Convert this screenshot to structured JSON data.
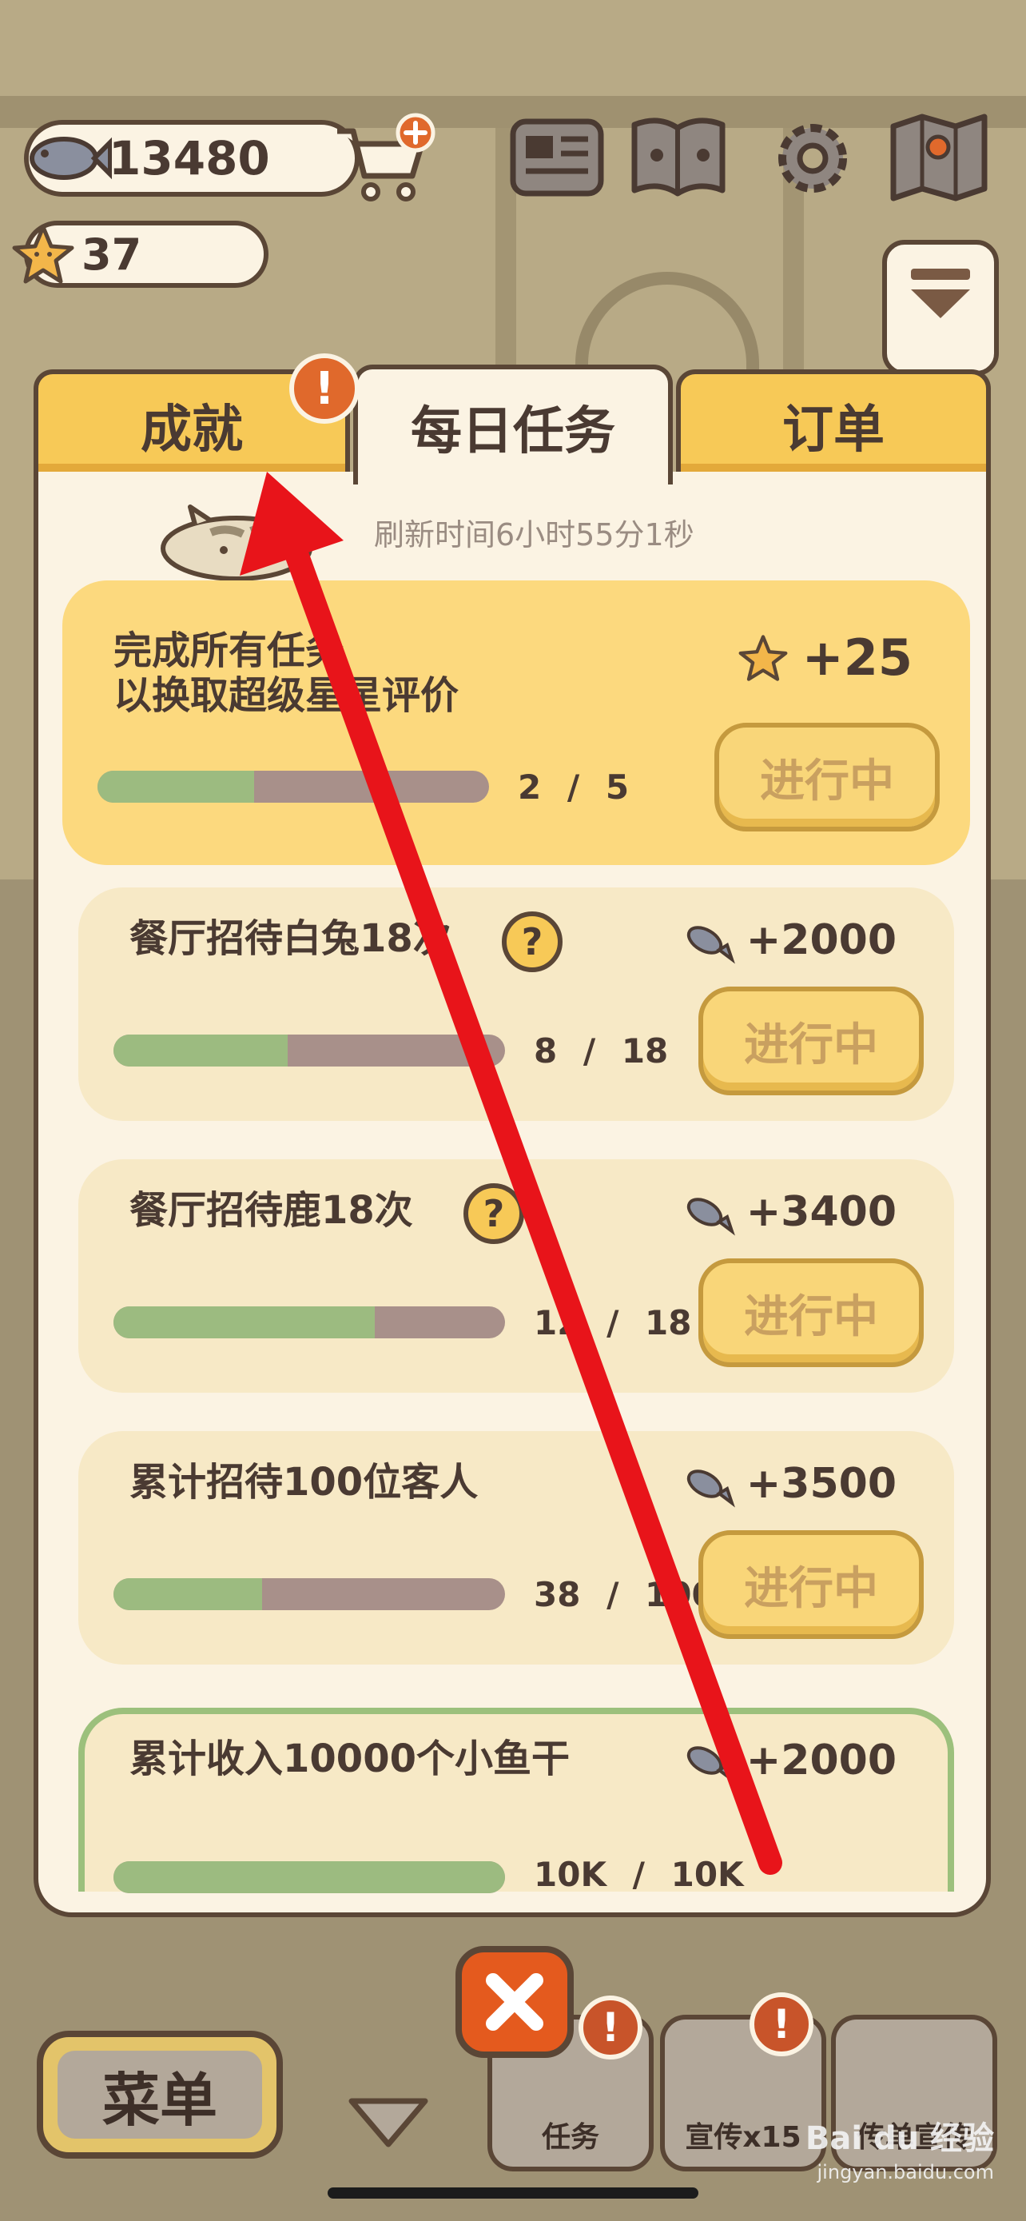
{
  "hud": {
    "coins": "13480",
    "stars": "37"
  },
  "tabs": [
    {
      "label": "成就",
      "active": false
    },
    {
      "label": "每日任务",
      "active": true
    },
    {
      "label": "订单",
      "active": false
    }
  ],
  "tab_alert": "!",
  "refresh_text": "刷新时间6小时55分1秒",
  "tasks": [
    {
      "title_line1": "完成所有任务",
      "title_line2": "以换取超级星星评价",
      "reward": "+25",
      "reward_icon": "star-icon",
      "progress_current": "2",
      "progress_total": "5",
      "progress_fraction": 0.4,
      "status": "进行中"
    },
    {
      "title": "餐厅招待白兔18次",
      "reward": "+2000",
      "reward_icon": "fish-icon",
      "progress_current": "8",
      "progress_total": "18",
      "progress_fraction": 0.444,
      "status": "进行中"
    },
    {
      "title": "餐厅招待鹿18次",
      "reward": "+3400",
      "reward_icon": "fish-icon",
      "progress_current": "12",
      "progress_total": "18",
      "progress_fraction": 0.667,
      "status": "进行中"
    },
    {
      "title": "累计招待100位客人",
      "reward": "+3500",
      "reward_icon": "fish-icon",
      "progress_current": "38",
      "progress_total": "100",
      "progress_fraction": 0.38,
      "status": "进行中"
    },
    {
      "title": "累计收入10000个小鱼干",
      "reward": "+2000",
      "reward_icon": "fish-icon",
      "progress_current": "10K",
      "progress_total": "10K",
      "progress_fraction": 1.0,
      "status": ""
    }
  ],
  "question_mark": "?",
  "bottom": {
    "menu_label": "菜单",
    "task_label": "任务",
    "promo_label": "宣传x15",
    "flyer_label": "传单宣传",
    "alert": "!"
  },
  "watermark": {
    "text": "Bai du 经验",
    "sub": "jingyan.baidu.com"
  },
  "colors": {
    "accent_yellow": "#f7c957",
    "panel_bg": "#fbf3e3",
    "outline": "#5a4636",
    "progress_fill": "#9cbb80",
    "progress_track": "#a8908a",
    "alert_orange": "#e0692c",
    "annotation_red": "#e8141a"
  }
}
